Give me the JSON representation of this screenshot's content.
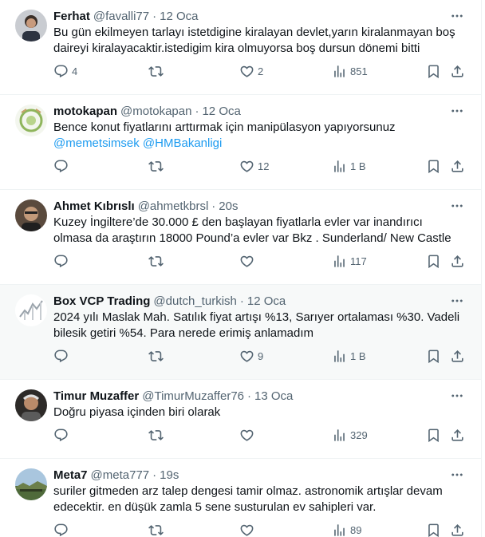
{
  "colors": {
    "text": "#0f1419",
    "muted": "#536471",
    "link": "#1d9bf0",
    "border": "#eff3f4",
    "hover_bg": "#f7f9f9"
  },
  "tweets": [
    {
      "name": "Ferhat",
      "handle": "@favalli77",
      "time": "12 Oca",
      "lines": [
        "Bu gün ekilmeyen tarlayı istetdigine kiralayan devlet,yarın kiralanmayan boş",
        "daireyi kiralayacaktir.istedigim kira olmuyorsa boş dursun dönemi bitti"
      ],
      "replies": "4",
      "retweets": "",
      "likes": "2",
      "views": "851"
    },
    {
      "name": "motokapan",
      "handle": "@motokapan",
      "time": "12 Oca",
      "lines": [
        "Bence konut fiyatlarını arttırmak için manipülasyon yapıyorsunuz"
      ],
      "mentions": [
        "@memetsimsek",
        "@HMBakanligi"
      ],
      "replies": "",
      "retweets": "",
      "likes": "12",
      "views": "1 B"
    },
    {
      "name": "Ahmet Kıbrıslı",
      "handle": "@ahmetkbrsl",
      "time": "20s",
      "lines": [
        "Kuzey İngiltere’de 30.000 £ den başlayan fiyatlarla evler var inandırıcı",
        "olmasa da araştırın 18000 Pound’a evler var Bkz . Sunderland/ New Castle"
      ],
      "replies": "",
      "retweets": "",
      "likes": "",
      "views": "117"
    },
    {
      "name": "Box VCP Trading",
      "handle": "@dutch_turkish",
      "time": "12 Oca",
      "lines": [
        "2024 yılı Maslak Mah. Satılık fiyat artışı %13, Sarıyer ortalaması %30. Vadeli",
        "bilesik getiri %54. Para nerede erimiş anlamadım"
      ],
      "replies": "",
      "retweets": "",
      "likes": "9",
      "views": "1 B"
    },
    {
      "name": "Timur Muzaffer",
      "handle": "@TimurMuzaffer76",
      "time": "13 Oca",
      "lines": [
        "Doğru piyasa içinden biri olarak"
      ],
      "replies": "",
      "retweets": "",
      "likes": "",
      "views": "329"
    },
    {
      "name": "Meta7",
      "handle": "@meta777",
      "time": "19s",
      "lines": [
        "suriler gitmeden arz talep dengesi tamir olmaz. astronomik artışlar devam",
        "edecektir. en düşük zamla 5 sene susturulan ev sahipleri var."
      ],
      "replies": "",
      "retweets": "",
      "likes": "",
      "views": "89"
    }
  ]
}
